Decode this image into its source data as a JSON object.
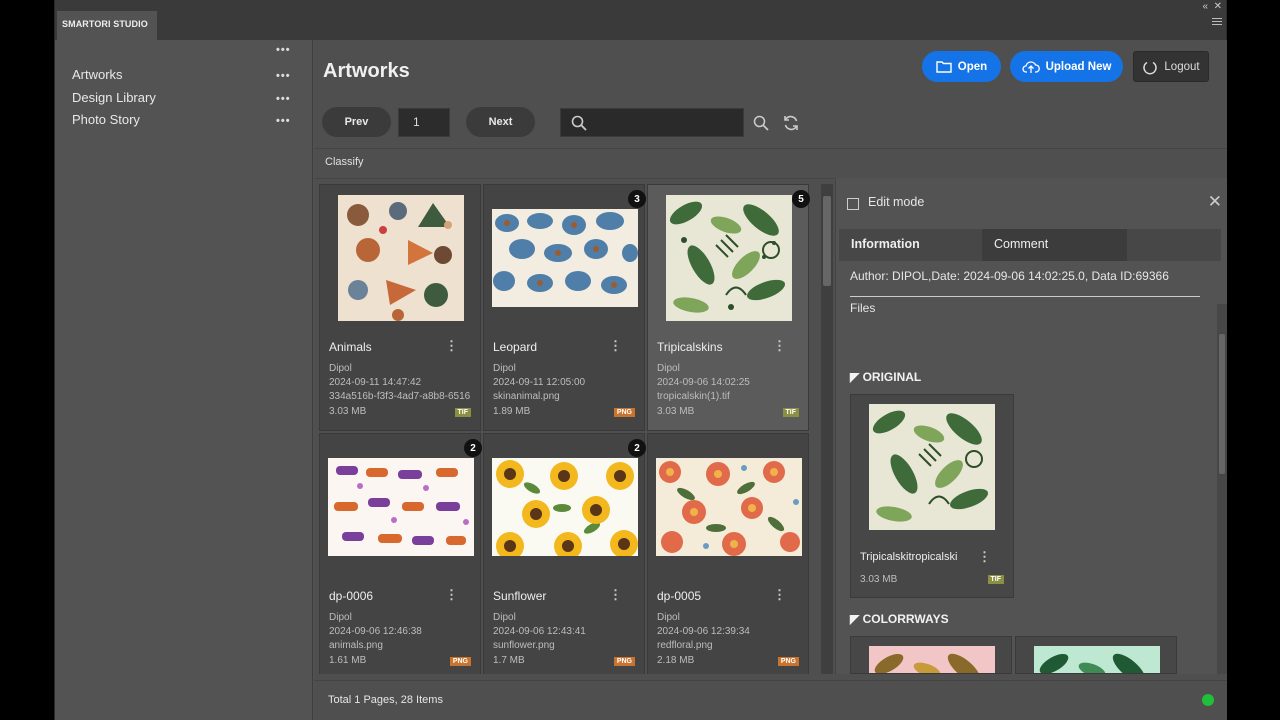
{
  "panel": {
    "tab_label": "SMARTORI STUDIO"
  },
  "sidebar": {
    "items": [
      {
        "label": "Artworks"
      },
      {
        "label": "Design Library"
      },
      {
        "label": "Photo Story"
      }
    ]
  },
  "header": {
    "title": "Artworks",
    "open_label": "Open",
    "upload_label": "Upload New",
    "logout_label": "Logout"
  },
  "pager": {
    "prev_label": "Prev",
    "page": "1",
    "next_label": "Next"
  },
  "search": {
    "placeholder": ""
  },
  "classify_label": "Classify",
  "artworks": [
    {
      "name": "Animals",
      "author": "Dipol",
      "date": "2024-09-11 14:47:42",
      "file": "334a516b-f3f3-4ad7-a8b8-6516",
      "size": "3.03 MB",
      "ext": "TIF",
      "count": "",
      "icon": "woodland-animals-pattern"
    },
    {
      "name": "Leopard",
      "author": "Dipol",
      "date": "2024-09-11 12:05:00",
      "file": "skinanimal.png",
      "size": "1.89 MB",
      "ext": "PNG",
      "count": "3",
      "icon": "leopard-spots-pattern"
    },
    {
      "name": "Tripicalskins",
      "author": "Dipol",
      "date": "2024-09-06 14:02:25",
      "file": "tropicalskin(1).tif",
      "size": "3.03 MB",
      "ext": "TIF",
      "count": "5",
      "icon": "tropical-leaves-pattern"
    },
    {
      "name": "dp-0006",
      "author": "Dipol",
      "date": "2024-09-06 12:46:38",
      "file": "animals.png",
      "size": "1.61 MB",
      "ext": "PNG",
      "count": "2",
      "icon": "purple-animals-pattern"
    },
    {
      "name": "Sunflower",
      "author": "Dipol",
      "date": "2024-09-06 12:43:41",
      "file": "sunflower.png",
      "size": "1.7 MB",
      "ext": "PNG",
      "count": "2",
      "icon": "sunflower-pattern"
    },
    {
      "name": "dp-0005",
      "author": "Dipol",
      "date": "2024-09-06 12:39:34",
      "file": "redfloral.png",
      "size": "2.18 MB",
      "ext": "PNG",
      "count": "",
      "icon": "red-floral-pattern"
    }
  ],
  "detail": {
    "edit_mode_label": "Edit mode",
    "tab_information": "Information",
    "tab_comment": "Comment",
    "info_line": "Author: DIPOL,Date: 2024-09-06 14:02:25.0, Data ID:69366",
    "files_label": "Files",
    "original_heading": "ORIGINAL",
    "original_file": {
      "name": "Tripicalskitropicalski",
      "size": "3.03 MB",
      "ext": "TIF"
    },
    "colorways_heading": "COLORRWAYS"
  },
  "footer": {
    "summary": "Total 1 Pages, 28 Items"
  },
  "colors": {
    "accent": "#1473e6",
    "status_online": "#1fbf3a",
    "png_badge": "#c8742e",
    "tif_badge": "#8a8f42"
  }
}
